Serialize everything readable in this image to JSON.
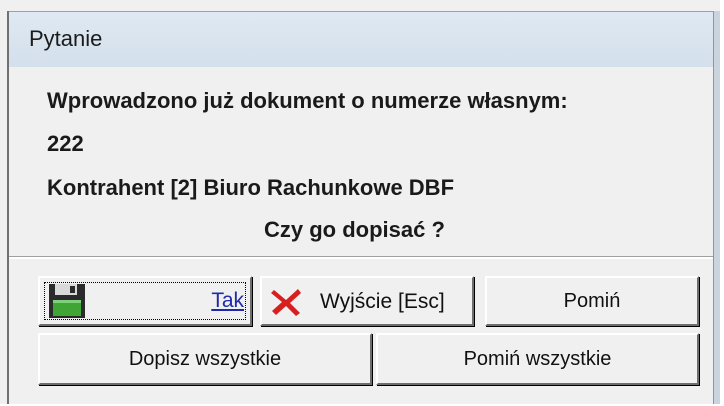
{
  "window": {
    "title": "Pytanie"
  },
  "message": {
    "line1": "Wprowadzono już dokument o numerze własnym:",
    "line2": "222",
    "line3": "Kontrahent [2] Biuro Rachunkowe DBF",
    "question": "Czy go dopisać ?"
  },
  "buttons": {
    "yes": {
      "label": "Tak",
      "icon": "floppy-disk-icon"
    },
    "exit": {
      "label": "Wyjście  [Esc]",
      "icon": "red-x-icon"
    },
    "skip": {
      "label": "Pomiń"
    },
    "add_all": {
      "label": "Dopisz wszystkie"
    },
    "skip_all": {
      "label": "Pomiń wszystkie"
    }
  },
  "colors": {
    "titlebar": "#d8e3ee",
    "dialog_bg": "#f0f0f0",
    "yes_label": "#1f2aa8",
    "exit_icon": "#d61f1f",
    "floppy_green": "#3fa535"
  }
}
